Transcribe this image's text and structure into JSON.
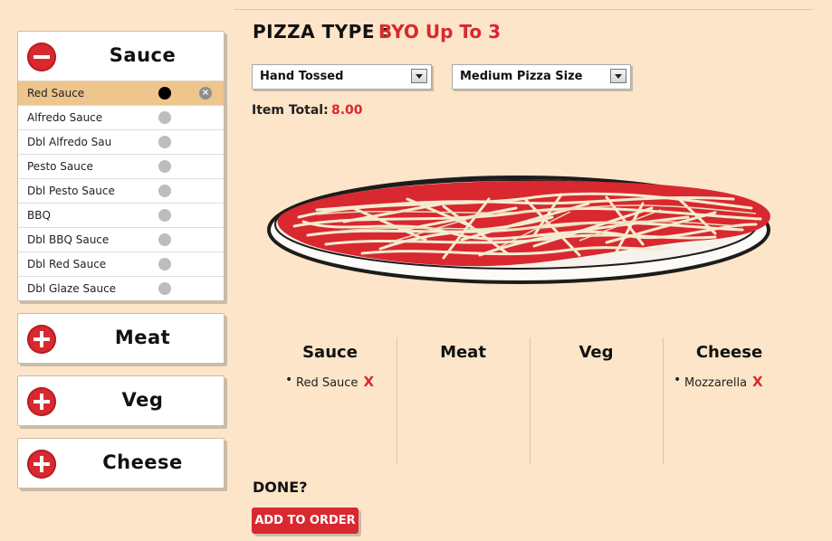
{
  "header": {
    "pizza_type_label": "PIZZA TYPE :",
    "pizza_type_value": "BYO Up To 3",
    "crust_select": "Hand Tossed",
    "size_select": "Medium Pizza Size",
    "item_total_label": "Item Total:",
    "item_total_value": "8.00"
  },
  "panels": {
    "sauce": {
      "title": "Sauce",
      "expanded": true,
      "icon": "minus-icon"
    },
    "meat": {
      "title": "Meat",
      "expanded": false,
      "icon": "plus-icon"
    },
    "veg": {
      "title": "Veg",
      "expanded": false,
      "icon": "plus-icon"
    },
    "cheese": {
      "title": "Cheese",
      "expanded": false,
      "icon": "plus-icon"
    }
  },
  "sauces": [
    {
      "label": "Red Sauce",
      "selected": true
    },
    {
      "label": "Alfredo Sauce",
      "selected": false
    },
    {
      "label": "Dbl Alfredo Sau",
      "selected": false
    },
    {
      "label": "Pesto Sauce",
      "selected": false
    },
    {
      "label": "Dbl Pesto Sauce",
      "selected": false
    },
    {
      "label": "BBQ",
      "selected": false
    },
    {
      "label": "Dbl BBQ Sauce",
      "selected": false
    },
    {
      "label": "Dbl Red Sauce",
      "selected": false
    },
    {
      "label": "Dbl Glaze Sauce",
      "selected": false
    }
  ],
  "summary": {
    "sauce": {
      "title": "Sauce",
      "items": [
        "Red Sauce"
      ]
    },
    "meat": {
      "title": "Meat",
      "items": []
    },
    "veg": {
      "title": "Veg",
      "items": []
    },
    "cheese": {
      "title": "Cheese",
      "items": [
        "Mozzarella"
      ]
    }
  },
  "remove_glyph": "X",
  "footer": {
    "done_label": "DONE?",
    "add_button": "ADD TO ORDER"
  },
  "colors": {
    "background": "#fce5c8",
    "accent_red": "#d9282f",
    "selected_row": "#edc58d"
  }
}
